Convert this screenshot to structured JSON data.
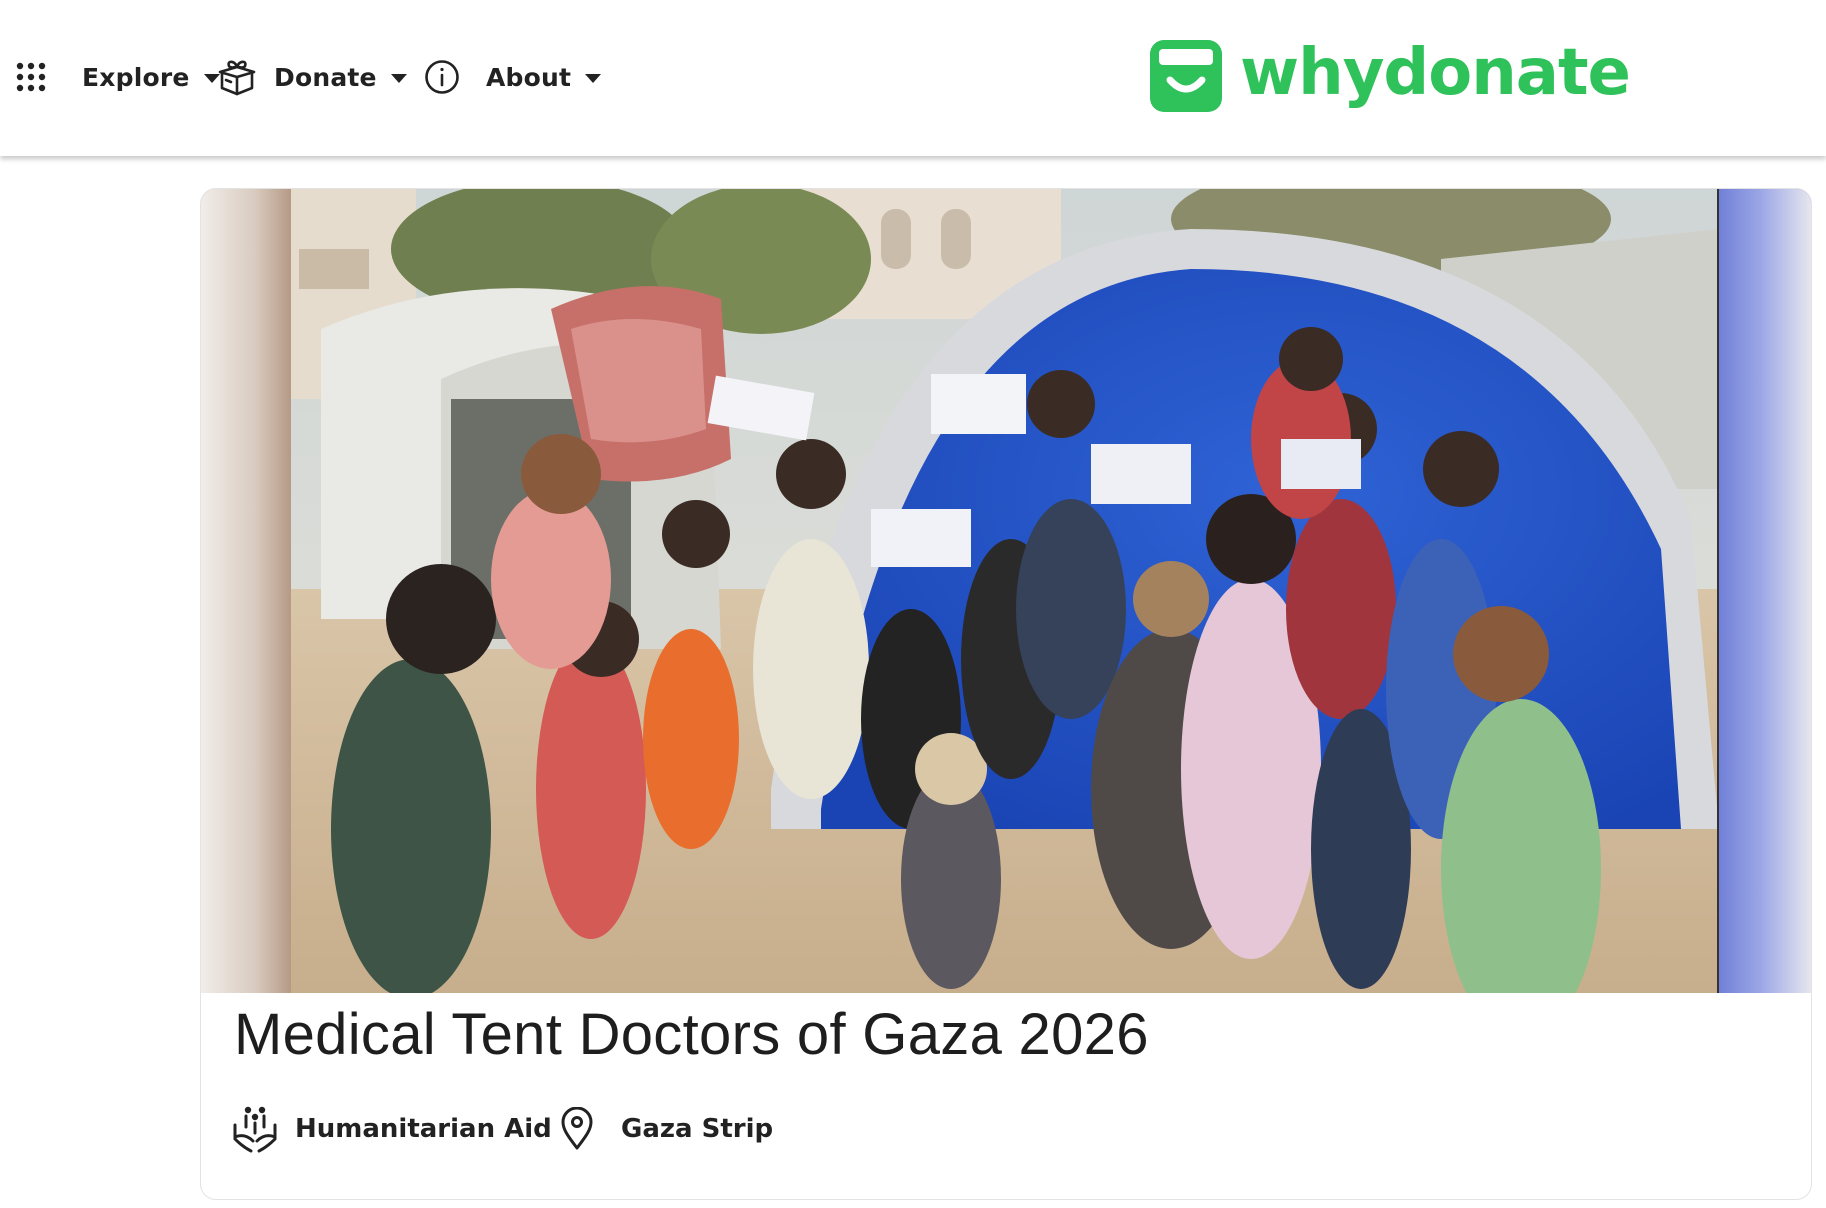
{
  "nav": {
    "explore": {
      "label": "Explore",
      "icon": "apps-grid-icon"
    },
    "donate": {
      "label": "Donate",
      "icon": "gift-box-icon"
    },
    "about": {
      "label": "About",
      "icon": "info-circle-icon"
    }
  },
  "brand": {
    "name": "whydonate",
    "color": "#2fc15a"
  },
  "campaign": {
    "title": "Medical Tent Doctors of Gaza 2026",
    "category": {
      "label": "Humanitarian Aid",
      "icon": "helping-hands-icon"
    },
    "location": {
      "label": "Gaza Strip",
      "icon": "map-pin-icon"
    }
  }
}
